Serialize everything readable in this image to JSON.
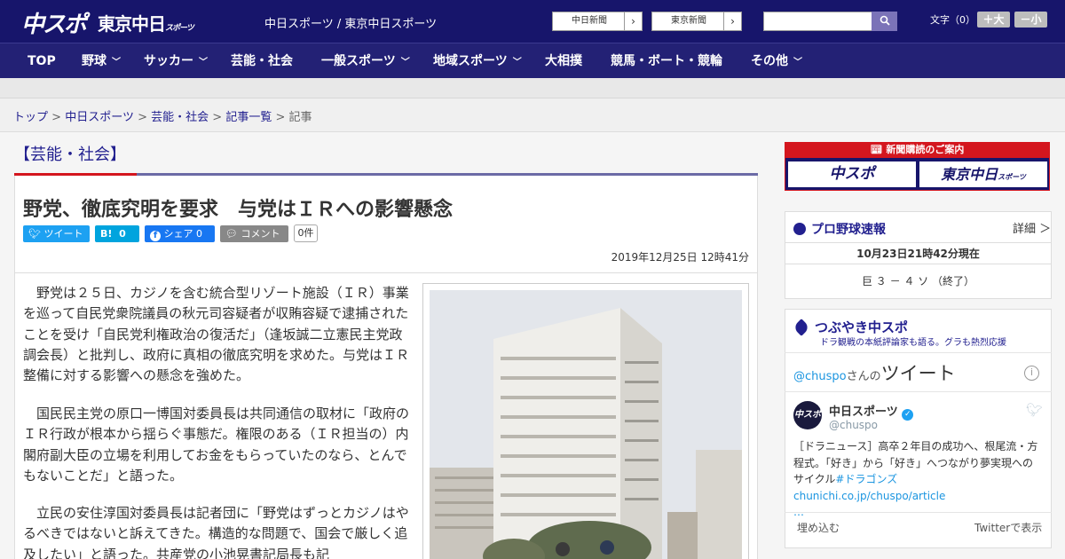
{
  "header": {
    "logo_chuspo": "中スポ",
    "logo_tokyo": "東京中日",
    "logo_tokyo_sub": "スポーツ",
    "site_links": "中日スポーツ / 東京中日スポーツ",
    "chunichi_btn": "中日新聞",
    "tokyo_btn": "東京新聞",
    "search_icon": "search-icon",
    "font_label": "文字（0）",
    "font_large": "＋大",
    "font_small": "－小"
  },
  "nav": {
    "items": [
      {
        "label": "TOP",
        "chevron": false
      },
      {
        "label": "野球",
        "chevron": true
      },
      {
        "label": "サッカー",
        "chevron": true
      },
      {
        "label": "芸能・社会",
        "chevron": false
      },
      {
        "label": "一般スポーツ",
        "chevron": true
      },
      {
        "label": "地域スポーツ",
        "chevron": true
      },
      {
        "label": "大相撲",
        "chevron": false
      },
      {
        "label": "競馬・ボート・競輪",
        "chevron": false
      },
      {
        "label": "その他",
        "chevron": true
      }
    ]
  },
  "breadcrumb": {
    "items": [
      "トップ",
      "中日スポーツ",
      "芸能・社会",
      "記事一覧"
    ],
    "current": "記事",
    "separator": ">"
  },
  "article": {
    "section": "【芸能・社会】",
    "title": "野党、徹底究明を要求　与党はＩＲへの影響懸念",
    "share": {
      "tweet": "ツイート",
      "hatena": "B!",
      "hatena_count": "0",
      "facebook": "シェア",
      "facebook_count": "0",
      "comment": "コメント",
      "comment_count": "0件"
    },
    "date": "2019年12月25日 12時41分",
    "paragraphs": [
      "　野党は２５日、カジノを含む統合型リゾート施設（ＩＲ）事業を巡って自民党衆院議員の秋元司容疑者が収賄容疑で逮捕されたことを受け「自民党利権政治の復活だ」（逢坂誠二立憲民主党政調会長）と批判し、政府に真相の徹底究明を求めた。与党はＩＲ整備に対する影響への懸念を強めた。",
      "　国民民主党の原口一博国対委員長は共同通信の取材に「政府のＩＲ行政が根本から揺らぐ事態だ。権限のある（ＩＲ担当の）内閣府副大臣の立場を利用してお金をもらっていたのなら、とんでもないことだ」と語った。",
      "　立民の安住淳国対委員長は記者団に「野党はずっとカジノはやるべきではないと訴えてきた。構造的な問題で、国会で厳しく追及したい」と語った。共産党の小池晃書記局長も記"
    ]
  },
  "sidebar": {
    "subscription": {
      "head": "新聞購読のご案内",
      "logo1": "中スポ",
      "logo2": "東京中日",
      "logo2_sub": "スポーツ"
    },
    "baseball": {
      "title": "プロ野球速報",
      "detail": "詳細 ＞",
      "updated": "10月23日21時42分現在",
      "score": "巨 ３ － ４ ソ （終了）"
    },
    "twitter": {
      "title": "つぶやき中スポ",
      "subtitle": "ドラ観戦の本紙評論家も語る。グラも熱烈応援",
      "handle_link": "@chuspo",
      "handle_suffix": "さんの",
      "tweets_label": "ツイート",
      "account_name": "中日スポーツ",
      "account_handle": "@chuspo",
      "avatar_text": "中スポ",
      "tweet_text": "［ドラニュース］高卒２年目の成功へ、根尾流・方程式。「好き」から「好き」へつながり夢実現へのサイクル",
      "tweet_link": "#ドラゴンズchunichi.co.jp/chuspo/article",
      "tweet_more": "…",
      "embed": "埋め込む",
      "view_on": "Twitterで表示"
    }
  }
}
